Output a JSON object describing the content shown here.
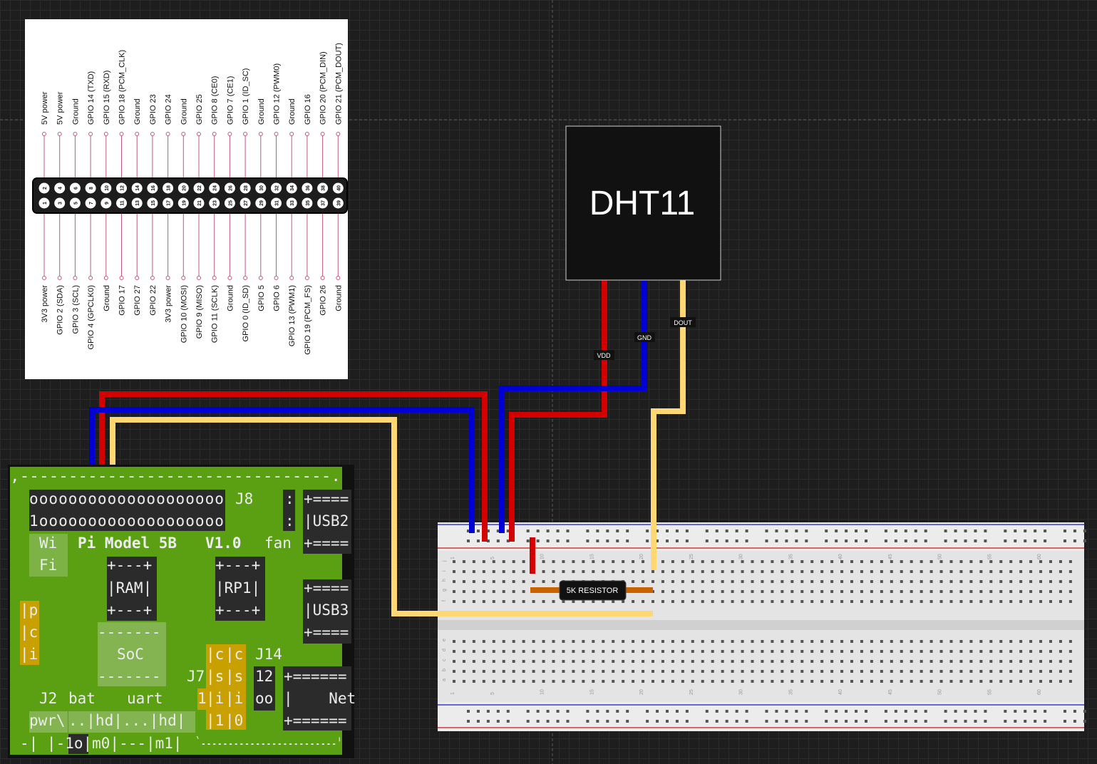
{
  "pinout": {
    "top_labels": [
      "5V power",
      "5V power",
      "Ground",
      "GPIO 14 (TXD)",
      "GPIO 15 (RXD)",
      "GPIO 18 (PCM_CLK)",
      "Ground",
      "GPIO 23",
      "GPIO 24",
      "Ground",
      "GPIO 25",
      "GPIO 8 (CE0)",
      "GPIO 7 (CE1)",
      "GPIO 1 (ID_SC)",
      "Ground",
      "GPIO 12 (PWM0)",
      "Ground",
      "GPIO 16",
      "GPIO 20 (PCM_DIN)",
      "GPIO 21 (PCM_DOUT)"
    ],
    "bottom_labels": [
      "3V3 power",
      "GPIO 2 (SDA)",
      "GPIO 3 (SCL)",
      "GPIO 4 (GPCLK0)",
      "Ground",
      "GPIO 17",
      "GPIO 27",
      "GPIO 22",
      "3V3 power",
      "GPIO 10 (MOSI)",
      "GPIO 9 (MISO)",
      "GPIO 11 (SCLK)",
      "Ground",
      "GPIO 0 (ID_SD)",
      "GPIO 5",
      "GPIO 6",
      "GPIO 13 (PWM1)",
      "GPIO 19 (PCM_FS)",
      "GPIO 26",
      "Ground"
    ],
    "top_pin_numbers": [
      "2",
      "4",
      "6",
      "8",
      "10",
      "12",
      "14",
      "16",
      "18",
      "20",
      "22",
      "24",
      "26",
      "28",
      "30",
      "32",
      "34",
      "36",
      "38",
      "40"
    ],
    "bottom_pin_numbers": [
      "1",
      "3",
      "5",
      "7",
      "9",
      "11",
      "13",
      "15",
      "17",
      "19",
      "21",
      "23",
      "25",
      "27",
      "29",
      "31",
      "33",
      "35",
      "37",
      "39"
    ]
  },
  "sensor": {
    "name": "DHT11",
    "pins": [
      {
        "label": "VDD",
        "color": "#d40000"
      },
      {
        "label": "GND",
        "color": "#0000d4"
      },
      {
        "label": "DOUT",
        "color": "#ffd873"
      }
    ]
  },
  "resistor": {
    "label": "5K RESISTOR",
    "color": "#c86400"
  },
  "breadboard": {
    "column_numbers": [
      "1",
      "5",
      "10",
      "15",
      "20",
      "25",
      "30",
      "35",
      "40",
      "45",
      "50",
      "55",
      "60"
    ],
    "row_letters_top": [
      "j",
      "i",
      "h",
      "g",
      "f"
    ],
    "row_letters_bottom": [
      "e",
      "d",
      "c",
      "b",
      "a"
    ]
  },
  "raspberry_pi": {
    "board_color": "#5aa012",
    "header_row1": "oooooooooooooooooooo",
    "header_row2": "1ooooooooooooooooooo",
    "header_label": "J8",
    "model_label": "Pi Model 5B",
    "version_label": "V1.0",
    "fan_label": "fan",
    "wifi_label": [
      "Wi",
      "Fi"
    ],
    "ram_label": "|RAM|",
    "rp1_label": "|RP1|",
    "soc_label": "SoC",
    "usb2_label": "|USB2",
    "usb3_label": "|USB3",
    "usb_rule": "+====",
    "net_rule": "+======",
    "net_label": "|    Net",
    "pci_labels": [
      "|p",
      "|c",
      "|i"
    ],
    "j14_label": "J14",
    "j7_label": "J7",
    "csi_col1": [
      "|c",
      "|s",
      "|i",
      "|1"
    ],
    "csi_col2": [
      "|c",
      "|s",
      "|i",
      "|0"
    ],
    "j14_values": [
      "12",
      "oo"
    ],
    "j2_label": "J2",
    "bat_label": "bat",
    "uart_label": "uart",
    "pwr_label": "pwr\\",
    "hdmi_row": "..|hd|...|hd|",
    "bottom_row": "-| |-1o|m0|---|m1|",
    "one_label": "1",
    "top_border": ",--------------------------------.",
    "bottom_border": "`-------------------------'"
  },
  "wires": {
    "red": "#d40000",
    "blue": "#0000d4",
    "yellow": "#ffd873"
  }
}
